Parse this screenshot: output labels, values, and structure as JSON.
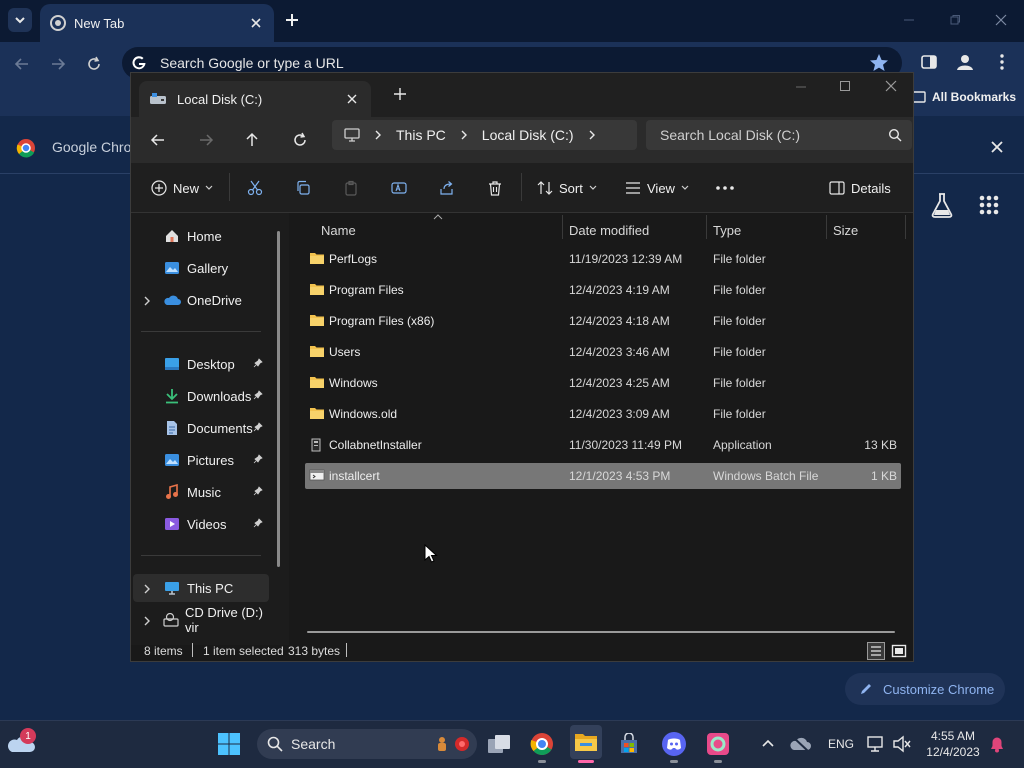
{
  "chrome": {
    "tab_title": "New Tab",
    "omnibox_placeholder": "Search Google or type a URL",
    "all_bookmarks": "All Bookmarks",
    "banner_text": "Google Chrome",
    "customize_label": "Customize Chrome"
  },
  "explorer": {
    "tab_title": "Local Disk (C:)",
    "breadcrumb": [
      "This PC",
      "Local Disk (C:)"
    ],
    "search_placeholder": "Search Local Disk (C:)",
    "toolbar": {
      "new": "New",
      "sort": "Sort",
      "view": "View",
      "more": "...",
      "details": "Details"
    },
    "nav": {
      "home": "Home",
      "gallery": "Gallery",
      "onedrive": "OneDrive",
      "desktop": "Desktop",
      "downloads": "Downloads",
      "documents": "Documents",
      "pictures": "Pictures",
      "music": "Music",
      "videos": "Videos",
      "this_pc": "This PC",
      "cd_drive": "CD Drive (D:) vir"
    },
    "columns": {
      "name": "Name",
      "date": "Date modified",
      "type": "Type",
      "size": "Size"
    },
    "files": [
      {
        "name": "PerfLogs",
        "date": "11/19/2023 12:39 AM",
        "type": "File folder",
        "size": ""
      },
      {
        "name": "Program Files",
        "date": "12/4/2023 4:19 AM",
        "type": "File folder",
        "size": ""
      },
      {
        "name": "Program Files (x86)",
        "date": "12/4/2023 4:18 AM",
        "type": "File folder",
        "size": ""
      },
      {
        "name": "Users",
        "date": "12/4/2023 3:46 AM",
        "type": "File folder",
        "size": ""
      },
      {
        "name": "Windows",
        "date": "12/4/2023 4:25 AM",
        "type": "File folder",
        "size": ""
      },
      {
        "name": "Windows.old",
        "date": "12/4/2023 3:09 AM",
        "type": "File folder",
        "size": ""
      },
      {
        "name": "CollabnetInstaller",
        "date": "11/30/2023 11:49 PM",
        "type": "Application",
        "size": "13 KB"
      },
      {
        "name": "installcert",
        "date": "12/1/2023 4:53 PM",
        "type": "Windows Batch File",
        "size": "1 KB"
      }
    ],
    "status": {
      "count": "8 items",
      "selected": "1 item selected",
      "size": "313 bytes"
    }
  },
  "taskbar": {
    "search_label": "Search",
    "weather_badge": "1",
    "lang": "ENG",
    "time": "4:55 AM",
    "date": "12/4/2023"
  },
  "colors": {
    "accent": "#0078d4",
    "folder": "#f2c24e",
    "selection": "#777777",
    "chrome_bg": "#13284a"
  }
}
